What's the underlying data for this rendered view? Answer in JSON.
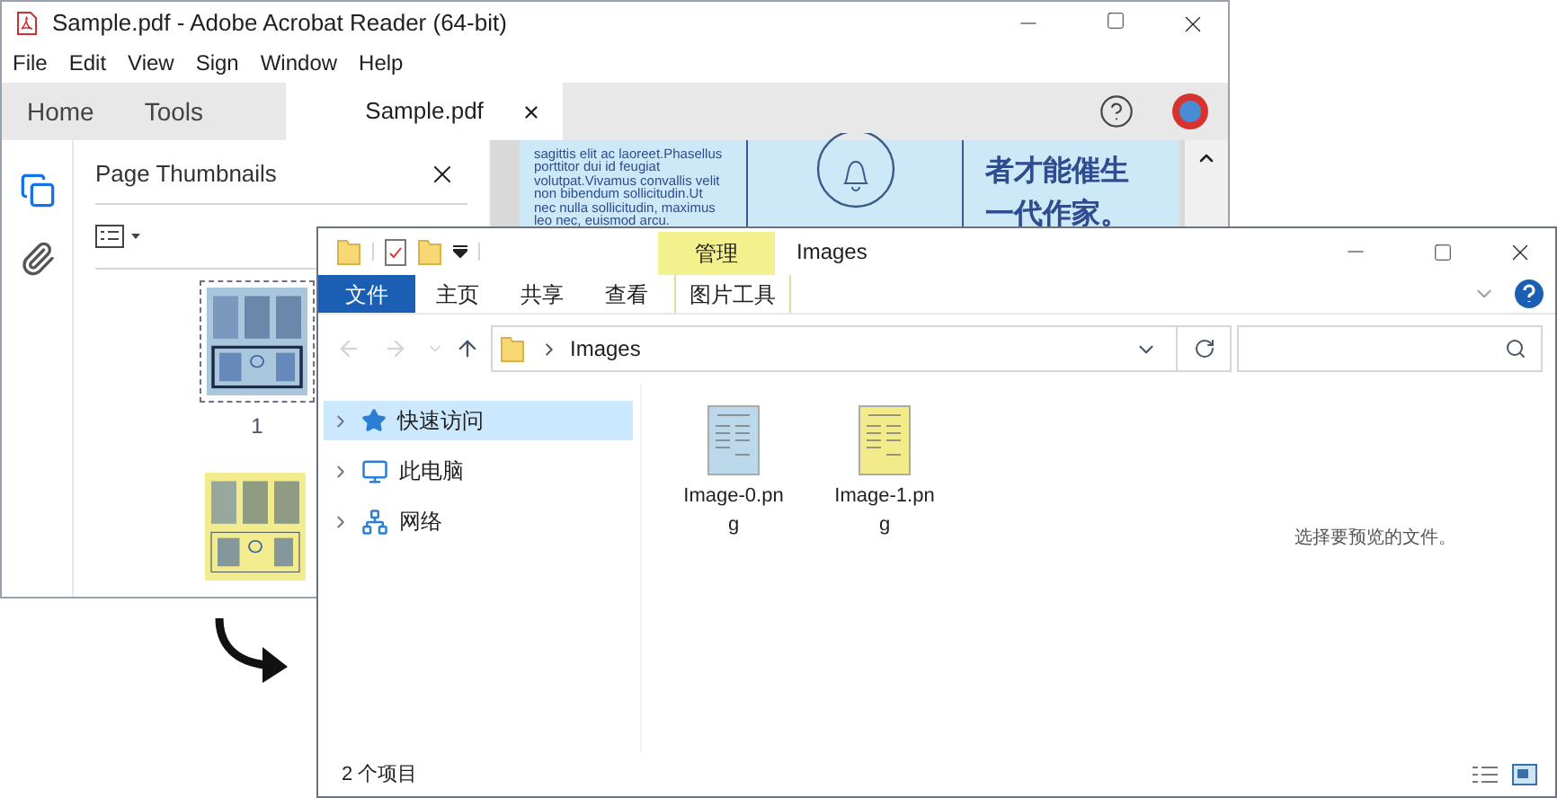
{
  "acrobat": {
    "title": "Sample.pdf - Adobe Acrobat Reader (64-bit)",
    "menu": [
      "File",
      "Edit",
      "View",
      "Sign",
      "Window",
      "Help"
    ],
    "tabs": [
      {
        "label": "Home",
        "selected": false
      },
      {
        "label": "Tools",
        "selected": false
      },
      {
        "label": "Sample.pdf",
        "selected": true
      }
    ],
    "panel": {
      "title": "Page Thumbnails",
      "thumbnails": [
        {
          "label": "1",
          "selected": true,
          "color": "#a9c6dc"
        },
        {
          "selected": false,
          "color": "#f3ec8f"
        }
      ]
    },
    "document": {
      "paragraph_lines": [
        "sagittis elit ac laoreet.Phasellus",
        "porttitor dui id feugiat",
        "volutpat.Vivamus convallis velit",
        "non bibendum sollicitudin.Ut",
        "nec nulla sollicitudin, maximus",
        "leo nec, euismod arcu."
      ],
      "heading_lines": [
        "者才能催生",
        "一代作家。"
      ]
    }
  },
  "explorer": {
    "title": "Images",
    "context_tab": "管理",
    "ribbon_tabs": [
      {
        "label": "文件",
        "kind": "file"
      },
      {
        "label": "主页",
        "kind": "tab"
      },
      {
        "label": "共享",
        "kind": "tab"
      },
      {
        "label": "查看",
        "kind": "tab"
      },
      {
        "label": "图片工具",
        "kind": "context"
      }
    ],
    "address": {
      "path": "Images"
    },
    "nav": [
      {
        "label": "快速访问",
        "kind": "quick",
        "selected": true
      },
      {
        "label": "此电脑",
        "kind": "pc",
        "selected": false
      },
      {
        "label": "网络",
        "kind": "network",
        "selected": false
      }
    ],
    "files": [
      {
        "name": "Image-0.png",
        "color": "#bcd9ec"
      },
      {
        "name": "Image-1.png",
        "color": "#f3ea8a"
      }
    ],
    "preview_hint": "选择要预览的文件。",
    "status": "2 个项目"
  }
}
